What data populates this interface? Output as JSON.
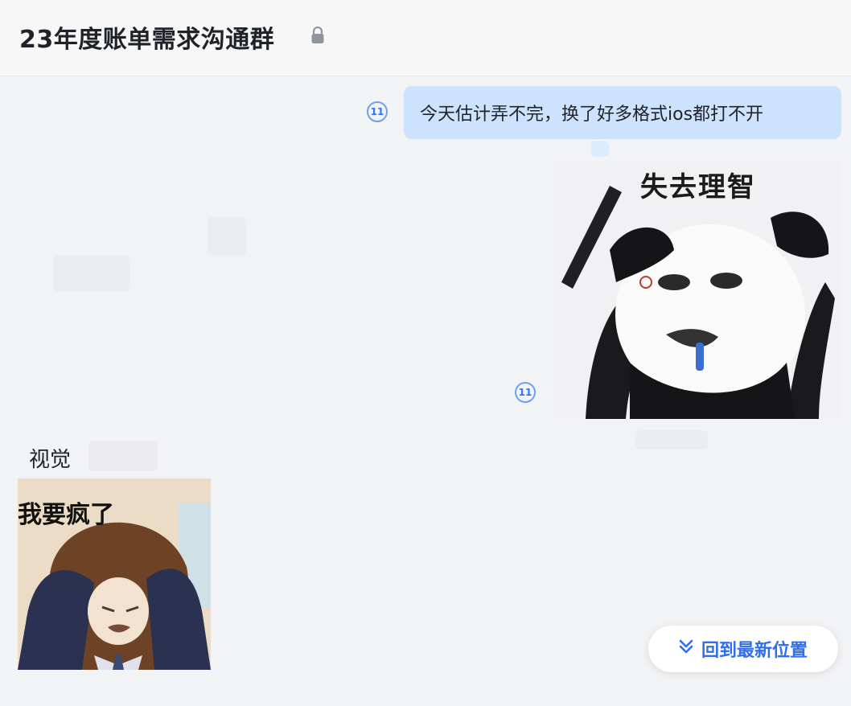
{
  "header": {
    "title": "23年度账单需求沟通群"
  },
  "messages": [
    {
      "side": "right",
      "type": "text",
      "text": "今天估计弄不完，换了好多格式ios都打不开",
      "read_count": "11"
    },
    {
      "side": "right",
      "type": "sticker",
      "caption": "失去理智",
      "read_count": "11"
    },
    {
      "side": "left",
      "type": "sticker",
      "sender": "视觉",
      "caption": "我要疯了"
    }
  ],
  "scroll_button": {
    "label": "回到最新位置"
  },
  "colors": {
    "accent": "#3370ff",
    "bubble_self": "#cce2fd",
    "background": "#f2f3f5"
  }
}
